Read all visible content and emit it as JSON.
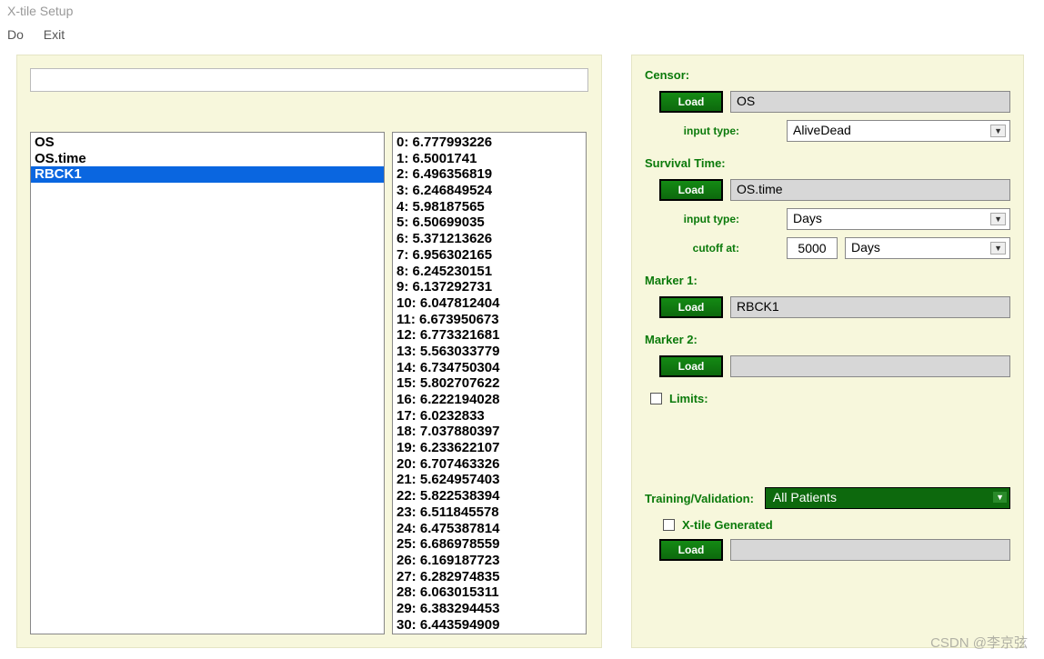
{
  "window": {
    "title": "X-tile Setup"
  },
  "menu": {
    "do": "Do",
    "exit": "Exit"
  },
  "variables": [
    {
      "label": "OS",
      "selected": false
    },
    {
      "label": "OS.time",
      "selected": false
    },
    {
      "label": "RBCK1",
      "selected": true
    }
  ],
  "values": [
    "0: 6.777993226",
    "1: 6.5001741",
    "2: 6.496356819",
    "3: 6.246849524",
    "4: 5.98187565",
    "5: 6.50699035",
    "6: 5.371213626",
    "7: 6.956302165",
    "8: 6.245230151",
    "9: 6.137292731",
    "10: 6.047812404",
    "11: 6.673950673",
    "12: 6.773321681",
    "13: 5.563033779",
    "14: 6.734750304",
    "15: 5.802707622",
    "16: 6.222194028",
    "17: 6.0232833",
    "18: 7.037880397",
    "19: 6.233622107",
    "20: 6.707463326",
    "21: 5.624957403",
    "22: 5.822538394",
    "23: 6.511845578",
    "24: 6.475387814",
    "25: 6.686978559",
    "26: 6.169187723",
    "27: 6.282974835",
    "28: 6.063015311",
    "29: 6.383294453",
    "30: 6.443594909"
  ],
  "censor": {
    "title": "Censor:",
    "load": "Load",
    "value": "OS",
    "input_type_label": "input type:",
    "input_type": "AliveDead"
  },
  "survival": {
    "title": "Survival Time:",
    "load": "Load",
    "value": "OS.time",
    "input_type_label": "input type:",
    "input_type": "Days",
    "cutoff_label": "cutoff at:",
    "cutoff_value": "5000",
    "cutoff_unit": "Days"
  },
  "marker1": {
    "title": "Marker 1:",
    "load": "Load",
    "value": "RBCK1"
  },
  "marker2": {
    "title": "Marker 2:",
    "load": "Load",
    "value": ""
  },
  "limits": {
    "label": "Limits:"
  },
  "training": {
    "label": "Training/Validation:",
    "value": "All Patients",
    "xtile_gen": "X-tile Generated",
    "load": "Load",
    "load_value": ""
  },
  "watermark": "CSDN @李京弦"
}
